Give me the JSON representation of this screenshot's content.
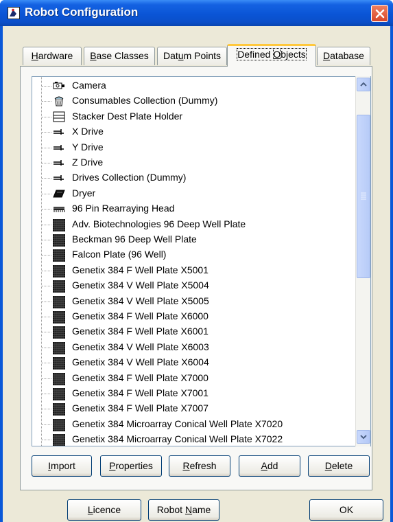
{
  "window": {
    "title": "Robot Configuration",
    "accent": "#0a58d8",
    "close_color": "#d8482a"
  },
  "tabs": [
    {
      "pre": "",
      "key": "H",
      "post": "ardware"
    },
    {
      "pre": "",
      "key": "B",
      "post": "ase Classes"
    },
    {
      "pre": "Dat",
      "key": "u",
      "post": "m Points"
    },
    {
      "pre": "Defined ",
      "key": "O",
      "post": "bjects"
    },
    {
      "pre": "",
      "key": "D",
      "post": "atabase"
    }
  ],
  "tree_items": [
    {
      "label": "Camera",
      "icon": "camera-icon"
    },
    {
      "label": "Consumables Collection (Dummy)",
      "icon": "consumables-icon"
    },
    {
      "label": "Stacker Dest Plate Holder",
      "icon": "plate-holder-icon"
    },
    {
      "label": "X Drive",
      "icon": "drive-icon"
    },
    {
      "label": "Y Drive",
      "icon": "drive-icon"
    },
    {
      "label": "Z Drive",
      "icon": "drive-icon"
    },
    {
      "label": "Drives Collection (Dummy)",
      "icon": "drive-icon"
    },
    {
      "label": "Dryer",
      "icon": "dryer-icon"
    },
    {
      "label": "96 Pin Rearraying Head",
      "icon": "pin-head-icon"
    },
    {
      "label": "Adv. Biotechnologies 96 Deep Well Plate",
      "icon": "well-plate-icon"
    },
    {
      "label": "Beckman 96 Deep Well Plate",
      "icon": "well-plate-icon"
    },
    {
      "label": "Falcon Plate (96 Well)",
      "icon": "well-plate-icon"
    },
    {
      "label": "Genetix 384 F Well Plate X5001",
      "icon": "well-plate-icon"
    },
    {
      "label": "Genetix 384 V Well Plate X5004",
      "icon": "well-plate-icon"
    },
    {
      "label": "Genetix 384 V Well Plate X5005",
      "icon": "well-plate-icon"
    },
    {
      "label": "Genetix 384 F Well Plate X6000",
      "icon": "well-plate-icon"
    },
    {
      "label": "Genetix 384 F Well Plate X6001",
      "icon": "well-plate-icon"
    },
    {
      "label": "Genetix 384 V Well Plate X6003",
      "icon": "well-plate-icon"
    },
    {
      "label": "Genetix 384 V Well Plate X6004",
      "icon": "well-plate-icon"
    },
    {
      "label": "Genetix 384 F Well Plate X7000",
      "icon": "well-plate-icon"
    },
    {
      "label": "Genetix 384 F Well Plate X7001",
      "icon": "well-plate-icon"
    },
    {
      "label": "Genetix 384 F Well Plate X7007",
      "icon": "well-plate-icon"
    },
    {
      "label": "Genetix 384 Microarray Conical Well Plate X7020",
      "icon": "well-plate-icon"
    },
    {
      "label": "Genetix 384 Microarray Conical Well Plate X7022",
      "icon": "well-plate-icon"
    }
  ],
  "panel_buttons": [
    {
      "pre": "",
      "key": "I",
      "post": "mport"
    },
    {
      "pre": "",
      "key": "P",
      "post": "roperties"
    },
    {
      "pre": "",
      "key": "R",
      "post": "efresh"
    },
    {
      "pre": "",
      "key": "A",
      "post": "dd"
    },
    {
      "pre": "",
      "key": "D",
      "post": "elete"
    }
  ],
  "footer_buttons": [
    {
      "pre": "",
      "key": "L",
      "post": "icence"
    },
    {
      "pre": "Robot ",
      "key": "N",
      "post": "ame"
    },
    {
      "pre": "OK",
      "key": "",
      "post": ""
    }
  ]
}
